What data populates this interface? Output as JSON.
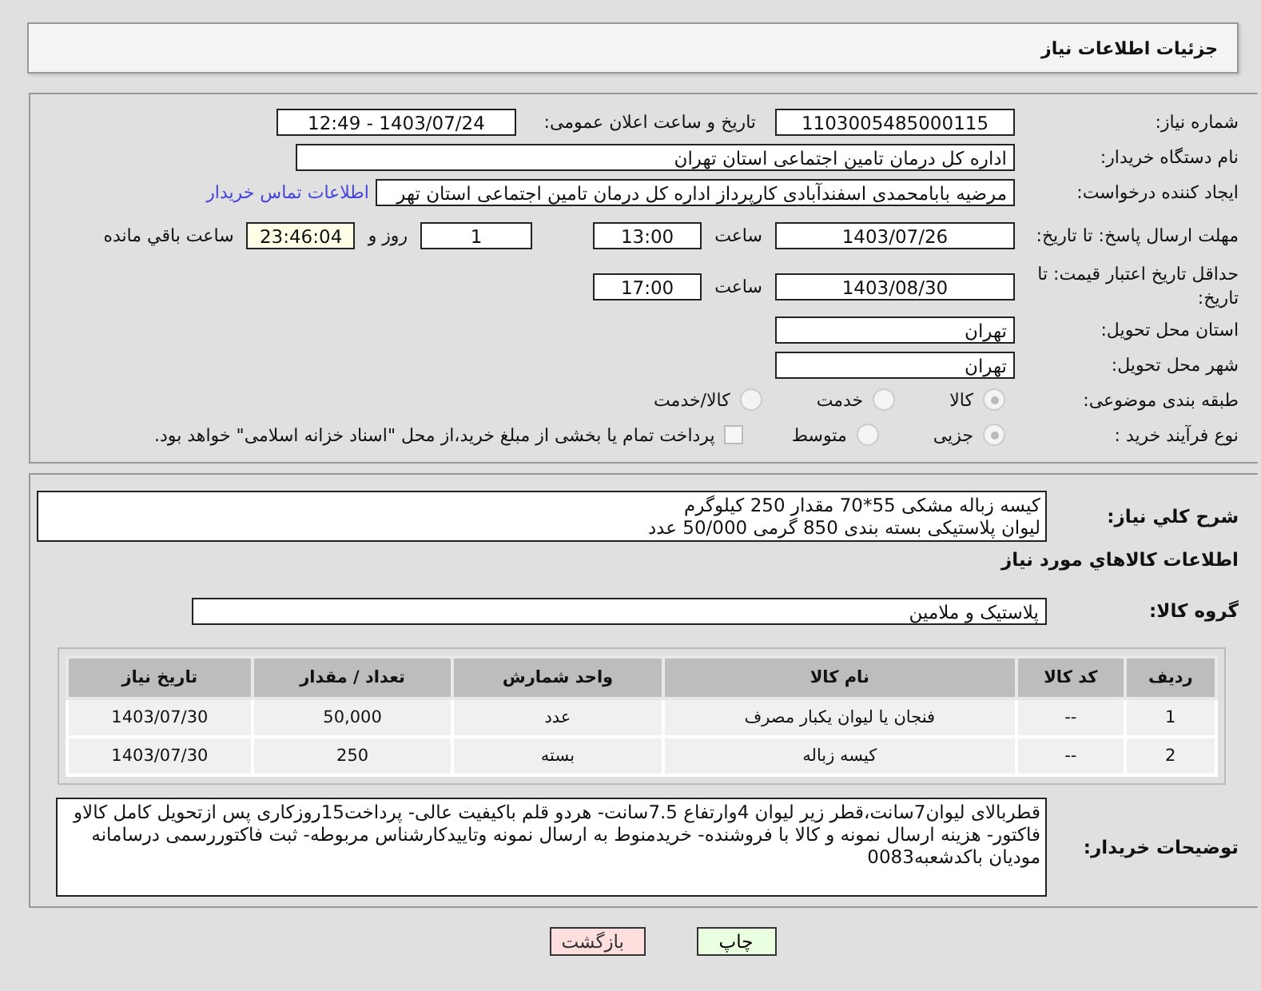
{
  "header": {
    "title": "جزئیات اطلاعات نیاز"
  },
  "need_number": {
    "label": "شماره نیاز:",
    "value": "1103005485000115"
  },
  "announce": {
    "label": "تاریخ و ساعت اعلان عمومی:",
    "value": "1403/07/24 - 12:49"
  },
  "buyer_org": {
    "label": "نام دستگاه خریدار:",
    "value": "اداره کل درمان تامین اجتماعی استان تهران"
  },
  "creator": {
    "label": "ایجاد کننده درخواست:",
    "value": "مرضیه بابامحمدی اسفندآبادی کارپرداز اداره کل درمان تامین اجتماعی استان تهر",
    "link": "اطلاعات تماس خریدار"
  },
  "deadline": {
    "label": "مهلت ارسال پاسخ: تا تاریخ:",
    "date": "1403/07/26",
    "time_label": "ساعت",
    "time": "13:00",
    "days": "1",
    "days_label": "روز و",
    "remaining": "23:46:04",
    "remaining_label": "ساعت باقي مانده"
  },
  "validity": {
    "label": "حداقل تاریخ اعتبار قیمت: تا تاریخ:",
    "date": "1403/08/30",
    "time_label": "ساعت",
    "time": "17:00"
  },
  "province": {
    "label": "استان محل تحویل:",
    "value": "تهران"
  },
  "city": {
    "label": "شهر محل تحویل:",
    "value": "تهران"
  },
  "category": {
    "label": "طبقه بندی موضوعی:",
    "options": [
      {
        "label": "کالا",
        "selected": true
      },
      {
        "label": "خدمت",
        "selected": false
      },
      {
        "label": "کالا/خدمت",
        "selected": false
      }
    ]
  },
  "process": {
    "label": "نوع فرآیند خرید :",
    "options": [
      {
        "label": "جزیی",
        "selected": true
      },
      {
        "label": "متوسط",
        "selected": false
      }
    ],
    "treasury": {
      "label": "پرداخت تمام یا بخشی از مبلغ خرید،از محل \"اسناد خزانه اسلامی\" خواهد بود.",
      "checked": false
    }
  },
  "description": {
    "label": "شرح کلي نیاز:",
    "lines": [
      "کیسه زباله مشکی 55*70 مقدار 250 کیلوگرم",
      "لیوان پلاستیکی بسته بندی 850 گرمی 50/000 عدد"
    ]
  },
  "items_heading": "اطلاعات کالاهاي مورد نیاز",
  "goods_group": {
    "label": "گروه کالا:",
    "value": "پلاستیک و ملامین"
  },
  "table": {
    "columns": [
      "ردیف",
      "کد کالا",
      "نام کالا",
      "واحد شمارش",
      "تعداد / مقدار",
      "تاریخ نیاز"
    ],
    "rows": [
      [
        "1",
        "--",
        "فنجان یا لیوان یکبار مصرف",
        "عدد",
        "50,000",
        "1403/07/30"
      ],
      [
        "2",
        "--",
        "کیسه زباله",
        "بسته",
        "250",
        "1403/07/30"
      ]
    ]
  },
  "buyer_notes": {
    "label": "توضیحات خریدار:",
    "value": "قطربالای لیوان7سانت،قطر زیر لیوان 4وارتفاع 7.5سانت- هردو قلم باکیفیت عالی- پرداخت15روزکاری پس ازتحویل کامل کالاو فاکتور- هزینه ارسال نمونه و کالا با فروشنده- خریدمنوط به ارسال نمونه وتاییدکارشناس مربوطه- ثبت فاکتوررسمی درسامانه مودیان باکدشعبه0083"
  },
  "buttons": [
    {
      "label": "چاپ",
      "kind": "print"
    },
    {
      "label": "بازگشت",
      "kind": "back"
    }
  ]
}
